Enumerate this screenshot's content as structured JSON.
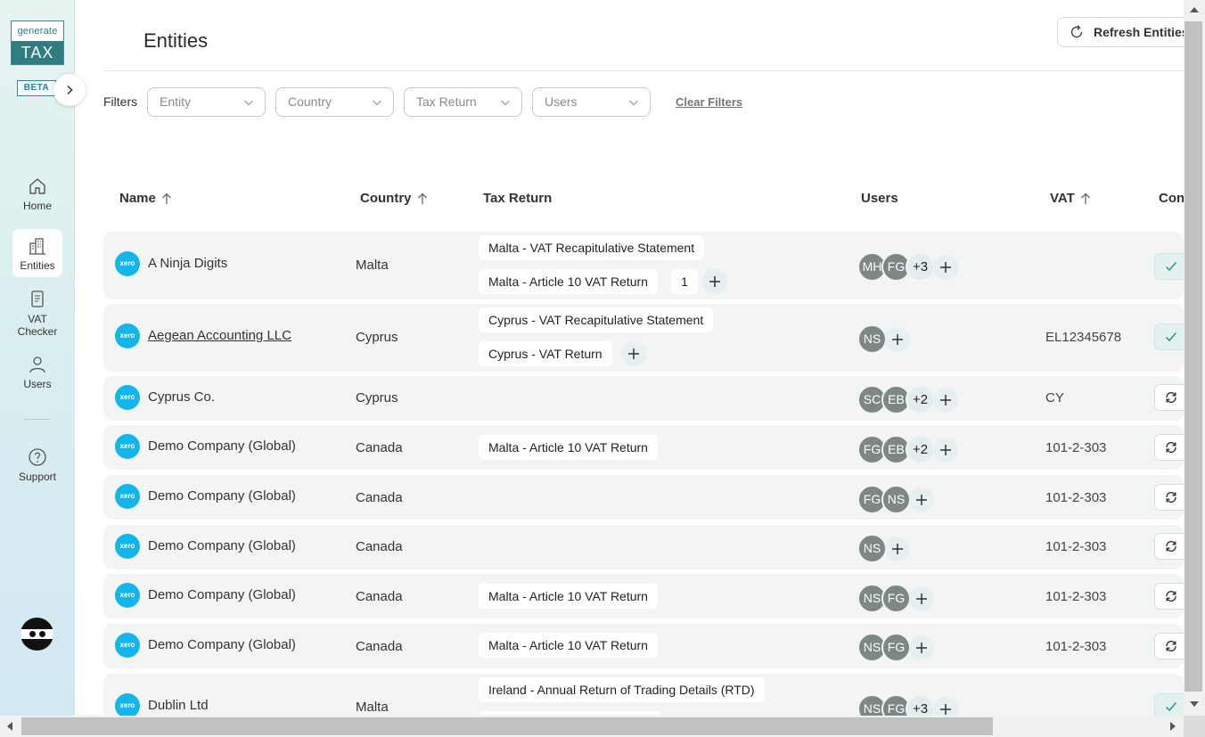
{
  "brand": {
    "logo_top": "generate",
    "logo_bottom": "TAX",
    "badge": "BETA"
  },
  "nav": [
    {
      "label": "Home"
    },
    {
      "label": "Entities"
    },
    {
      "label": "VAT\nChecker",
      "line1": "VAT",
      "line2": "Checker"
    },
    {
      "label": "Users"
    },
    {
      "label": "Support"
    }
  ],
  "header": {
    "title": "Entities",
    "refresh_label": "Refresh Entities"
  },
  "filters": {
    "label": "Filters",
    "entity": "Entity",
    "country": "Country",
    "tax_return": "Tax Return",
    "users": "Users",
    "clear": "Clear Filters"
  },
  "columns": {
    "name": "Name",
    "country": "Country",
    "tax_return": "Tax Return",
    "users": "Users",
    "vat": "VAT",
    "con": "Con"
  },
  "rows": [
    {
      "name": "A Ninja Digits",
      "country": "Malta",
      "returns": [
        "Malta - VAT Recapitulative Statement",
        "Malta - Article 10 VAT Return"
      ],
      "extra_count": "1",
      "users": [
        "MH",
        "FG"
      ],
      "more": "+3",
      "vat": "",
      "status": "check"
    },
    {
      "name": "Aegean Accounting LLC",
      "country": "Cyprus",
      "returns": [
        "Cyprus - VAT Recapitulative Statement",
        "Cyprus - VAT Return"
      ],
      "users": [
        "NS"
      ],
      "vat": "EL12345678",
      "status": "check"
    },
    {
      "name": "Cyprus Co.",
      "country": "Cyprus",
      "returns": [],
      "users": [
        "SC",
        "EB"
      ],
      "more": "+2",
      "vat": "CY",
      "status": "sync"
    },
    {
      "name": "Demo Company (Global)",
      "country": "Canada",
      "returns": [
        "Malta - Article 10 VAT Return"
      ],
      "users": [
        "FG",
        "EB"
      ],
      "more": "+2",
      "vat": "101-2-303",
      "status": "sync"
    },
    {
      "name": "Demo Company (Global)",
      "country": "Canada",
      "returns": [],
      "users": [
        "FG",
        "NS"
      ],
      "vat": "101-2-303",
      "status": "sync"
    },
    {
      "name": "Demo Company (Global)",
      "country": "Canada",
      "returns": [],
      "users": [
        "NS"
      ],
      "vat": "101-2-303",
      "status": "sync"
    },
    {
      "name": "Demo Company (Global)",
      "country": "Canada",
      "returns": [
        "Malta - Article 10 VAT Return"
      ],
      "users": [
        "NS",
        "FG"
      ],
      "vat": "101-2-303",
      "status": "sync"
    },
    {
      "name": "Demo Company (Global)",
      "country": "Canada",
      "returns": [
        "Malta - Article 10 VAT Return"
      ],
      "users": [
        "NS",
        "FG"
      ],
      "vat": "101-2-303",
      "status": "sync"
    },
    {
      "name": "Dublin Ltd",
      "country": "Malta",
      "returns": [
        "Ireland - Annual Return of Trading Details (RTD)"
      ],
      "users": [
        "NS",
        "FG"
      ],
      "more": "+3",
      "vat": "",
      "status": "check"
    }
  ],
  "xero_label": "xero",
  "colors": {
    "accent": "#2f7d7f",
    "xero": "#13b5ea",
    "avatar": "#7c8786",
    "row_bg": "#f3f4f4"
  }
}
